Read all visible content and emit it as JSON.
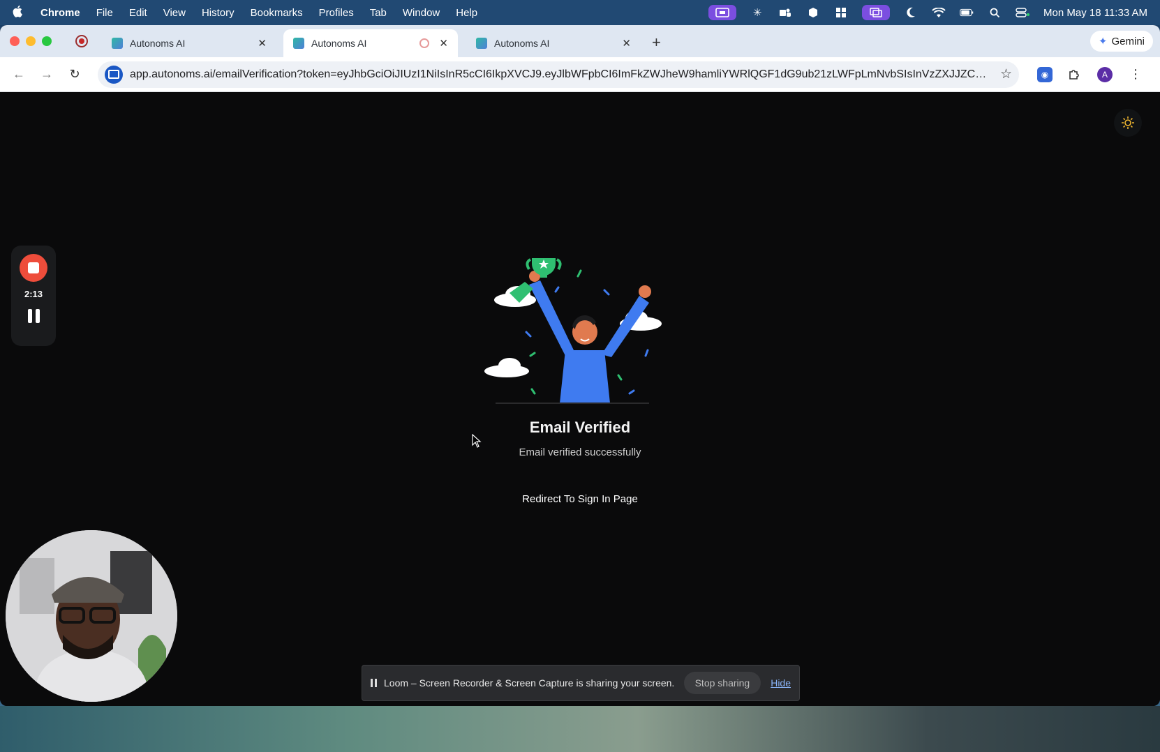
{
  "menubar": {
    "app": "Chrome",
    "items": [
      "File",
      "Edit",
      "View",
      "History",
      "Bookmarks",
      "Profiles",
      "Tab",
      "Window",
      "Help"
    ],
    "clock": "Mon May 18  11:33 AM"
  },
  "tabs": [
    {
      "title": "Autonoms AI",
      "active": false
    },
    {
      "title": "Autonoms AI",
      "active": true
    },
    {
      "title": "Autonoms AI",
      "active": false
    }
  ],
  "gemini": {
    "label": "Gemini"
  },
  "omnibox": {
    "url": "app.autonoms.ai/emailVerification?token=eyJhbGciOiJIUzI1NiIsInR5cCI6IkpXVCJ9.eyJlbWFpbCI6ImFkZWJheW9hamliYWRlQGF1dG9ub21zLWFpLmNvbSIsInVzZXJJZCI6Ij..."
  },
  "profile": {
    "initial": "A"
  },
  "page": {
    "heading": "Email Verified",
    "subheading": "Email verified successfully",
    "redirect_label": "Redirect To Sign In Page"
  },
  "loom": {
    "timer": "2:13",
    "share_message": "Loom – Screen Recorder & Screen Capture is sharing your screen.",
    "stop_label": "Stop sharing",
    "hide_label": "Hide"
  },
  "colors": {
    "accent_green": "#2fbf71",
    "figure_blue": "#3f7bf0",
    "loom_red": "#ee4d3b",
    "theme_icon": "#f2b830"
  }
}
